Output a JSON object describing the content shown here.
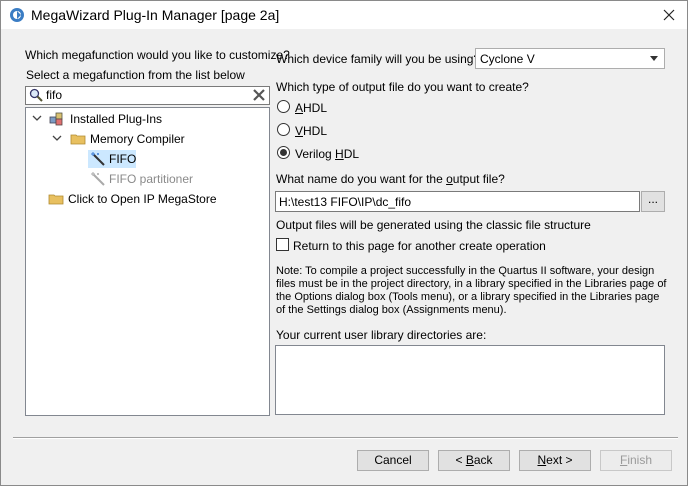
{
  "window": {
    "title": "MegaWizard Plug-In Manager [page 2a]"
  },
  "left": {
    "question": "Which megafunction would you like to customize?",
    "instruction": "Select a megafunction from the list below",
    "search_value": "fifo",
    "tree": {
      "installed": "Installed Plug-Ins",
      "memory_compiler": "Memory Compiler",
      "fifo": "FIFO",
      "fifo_partitioner": "FIFO partitioner",
      "megastore": "Click to Open IP MegaStore"
    }
  },
  "right": {
    "device_question": "Which device family will you be using?",
    "device_value": "Cyclone V",
    "output_type_question": "Which type of output file do you want to create?",
    "radio": {
      "ahdl": {
        "first": "A",
        "rest": "HDL",
        "checked": false
      },
      "vhdl": {
        "first": "V",
        "rest": "HDL",
        "checked": false
      },
      "verilog": {
        "pre": "Verilog ",
        "first": "H",
        "rest": "DL",
        "checked": true
      }
    },
    "name_question_pre": "What name do you want for the ",
    "name_question_o": "o",
    "name_question_post": "utput file?",
    "output_path": "H:\\test13 FIFO\\IP\\dc_fifo",
    "browse_label": "...",
    "classic_note": "Output files will be generated using the classic file structure",
    "return_checkbox_label": "Return to this page for another create operation",
    "return_checked": false,
    "note": "Note: To compile a project successfully in the Quartus II software, your design files must be in the project directory, in a library specified in the Libraries page of the Options dialog box (Tools menu), or a library specified in the Libraries page of the Settings dialog box (Assignments menu).",
    "library_label": "Your current user library directories are:"
  },
  "buttons": {
    "cancel": "Cancel",
    "back_pre": "< ",
    "back_u": "B",
    "back_post": "ack",
    "next_u": "N",
    "next_post": "ext >",
    "finish_u": "F",
    "finish_post": "inish"
  }
}
